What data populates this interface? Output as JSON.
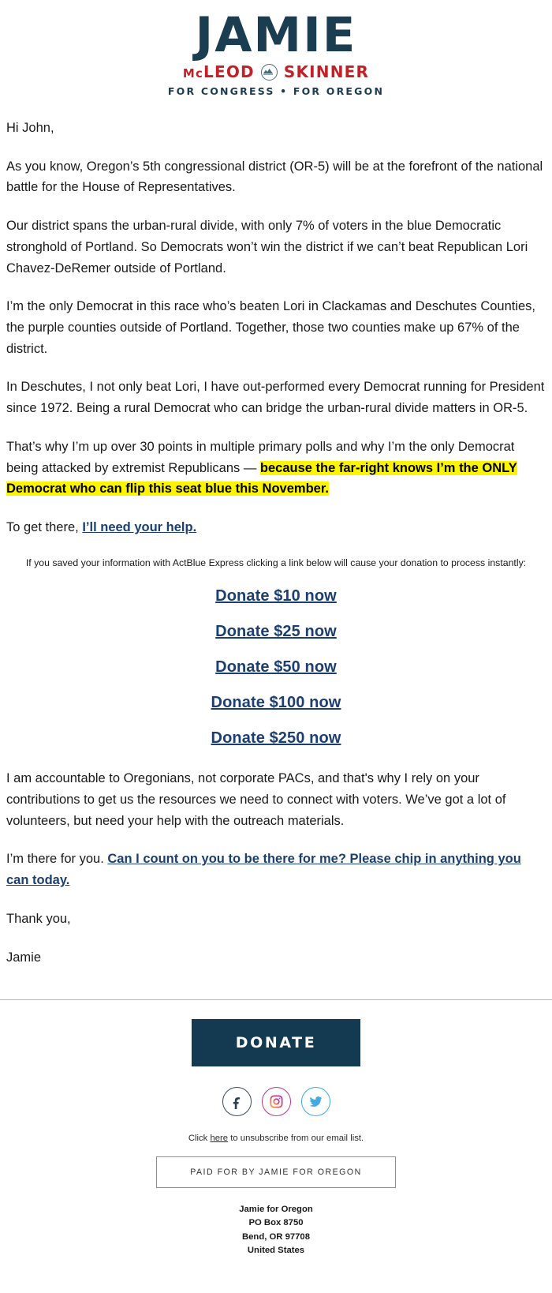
{
  "logo": {
    "name": "JAMIE",
    "surname_left_small": "Mc",
    "surname_left": "LEOD",
    "surname_right": "SKINNER",
    "tagline": "FOR CONGRESS • FOR OREGON",
    "navy": "#1b3d52",
    "red": "#c32027"
  },
  "letter": {
    "greeting": "Hi John,",
    "p1": "As you know, Oregon’s 5th congressional district (OR-5) will be at the forefront of the national battle for the House of Representatives.",
    "p2": "Our district spans the urban-rural divide, with only 7% of voters in the blue Democratic stronghold of Portland. So Democrats won’t win the district if we can’t beat Republican Lori Chavez-DeRemer outside of Portland.",
    "p3": "I’m the only Democrat in this race who’s beaten Lori in Clackamas and Deschutes Counties, the purple counties outside of Portland. Together, those two counties make up 67% of the district.",
    "p4": "In Deschutes, I not only beat Lori, I have out-performed every Democrat running for President since 1972. Being a rural Democrat who can bridge the urban-rural divide matters in OR-5.",
    "p5_plain": "That’s why I’m up over 30 points in multiple primary polls and why I’m the only Democrat being attacked by extremist Republicans — ",
    "p5_highlight": "because the far-right knows I’m the ONLY Democrat who can flip this seat blue this November.",
    "p6_plain": "To get there, ",
    "p6_link": "I’ll need your help.",
    "actblue_note": "If you saved your information with ActBlue Express clicking a link below will cause your donation to process instantly:",
    "p7": "I am accountable to Oregonians, not corporate PACs, and that's why I rely on your contributions to get us the resources we need to connect with voters. We’ve got a lot of volunteers, but need your help with the outreach materials.",
    "p8_plain": "I’m there for you. ",
    "p8_link": "Can I count on you to be there for me? Please chip in anything you can today.",
    "closing": "Thank you,",
    "signature": "Jamie",
    "highlight_color": "#fdf500",
    "link_color": "#1c3f73"
  },
  "donate_links": [
    {
      "label": "Donate $10 now",
      "amount": 10
    },
    {
      "label": "Donate $25 now",
      "amount": 25
    },
    {
      "label": "Donate $50 now",
      "amount": 50
    },
    {
      "label": "Donate $100 now",
      "amount": 100
    },
    {
      "label": "Donate $250 now",
      "amount": 250
    }
  ],
  "footer": {
    "donate_button": "DONATE",
    "donate_button_color": "#143a52",
    "social": [
      {
        "name": "facebook",
        "glyph": "f"
      },
      {
        "name": "instagram",
        "glyph": ""
      },
      {
        "name": "twitter",
        "glyph": ""
      }
    ],
    "unsubscribe_pre": "Click ",
    "unsubscribe_link": "here",
    "unsubscribe_post": " to unsubscribe from our email list.",
    "disclaimer": "PAID FOR BY JAMIE FOR OREGON",
    "address": [
      "Jamie for Oregon",
      "PO Box 8750",
      "Bend, OR 97708",
      "United States"
    ]
  }
}
